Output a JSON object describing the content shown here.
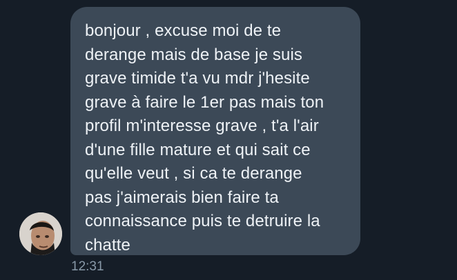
{
  "conversation": {
    "message": {
      "text": "bonjour , excuse moi de te\nderange mais de base je suis\ngrave timide t'a vu mdr j'hesite\ngrave à faire le 1er pas mais ton\nprofil m'interesse grave , t'a l'air\nd'une fille mature et qui sait ce\nqu'elle veut , si ca te derange\npas j'aimerais bien faire ta\nconnaissance puis te detruire la\nchatte",
      "timestamp": "12:31",
      "sender_avatar": "profile-photo"
    }
  },
  "colors": {
    "background": "#151d27",
    "bubble": "#3c4957",
    "text": "#eef2f6",
    "timestamp": "#8899a8"
  }
}
